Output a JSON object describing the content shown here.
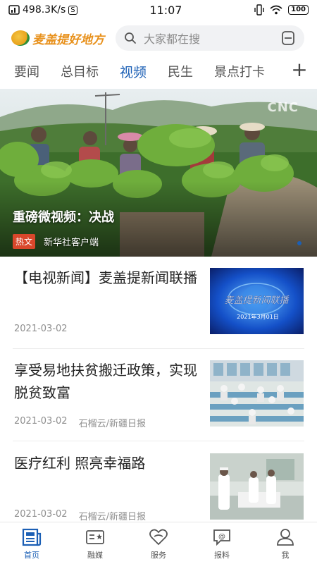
{
  "status_bar": {
    "net_speed": "498.3K/s",
    "time": "11:07",
    "battery": "100"
  },
  "header": {
    "logo_text": "麦盖提好地方",
    "search_placeholder": "大家都在搜"
  },
  "tabs": [
    {
      "label": "要闻",
      "active": false
    },
    {
      "label": "总目标",
      "active": false
    },
    {
      "label": "视频",
      "active": true
    },
    {
      "label": "民生",
      "active": false
    },
    {
      "label": "景点打卡",
      "active": false
    }
  ],
  "hero": {
    "title": "重磅微视频：决战",
    "tag": "热文",
    "source": "新华社客户端",
    "watermark": "CNC"
  },
  "news": [
    {
      "title": "【电视新闻】麦盖提新闻联播",
      "date": "2021-03-02",
      "source": "",
      "thumb_title": "麦盖提新闻联播",
      "thumb_date": "2021年3月01日"
    },
    {
      "title": "享受易地扶贫搬迁政策，实现脱贫致富",
      "date": "2021-03-02",
      "source": "石榴云/新疆日报"
    },
    {
      "title": "医疗红利 照亮幸福路",
      "date": "2021-03-02",
      "source": "石榴云/新疆日报"
    }
  ],
  "bottom_nav": [
    {
      "label": "首页",
      "icon": "newspaper-icon",
      "active": true
    },
    {
      "label": "融媒",
      "icon": "media-card-icon",
      "active": false
    },
    {
      "label": "服务",
      "icon": "heart-service-icon",
      "active": false
    },
    {
      "label": "报料",
      "icon": "report-bubble-icon",
      "active": false
    },
    {
      "label": "我",
      "icon": "person-icon",
      "active": false
    }
  ],
  "colors": {
    "accent": "#1b5fb5",
    "hot_tag": "#d9472b",
    "logo": "#e8911c"
  }
}
